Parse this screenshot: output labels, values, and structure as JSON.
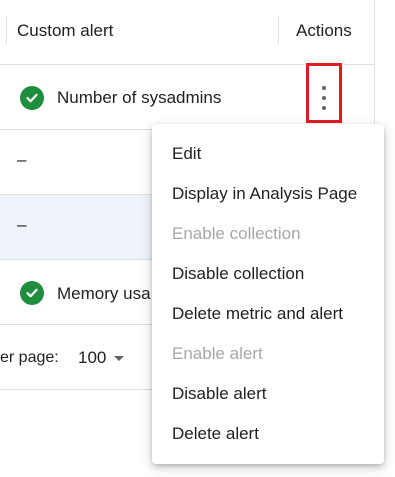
{
  "table": {
    "headers": {
      "custom_alert": "Custom alert",
      "actions": "Actions"
    },
    "rows": [
      {
        "status_icon": "check-circle-icon",
        "name": "Number of sysadmins"
      },
      {
        "name": "–"
      },
      {
        "name": "–",
        "selected": true
      },
      {
        "status_icon": "check-circle-icon",
        "name": "Memory usa"
      }
    ]
  },
  "pagination": {
    "rows_per_page_label": "er page:",
    "rows_per_page_value": "100"
  },
  "menu": {
    "items": [
      {
        "label": "Edit",
        "enabled": true
      },
      {
        "label": "Display in Analysis Page",
        "enabled": true
      },
      {
        "label": "Enable collection",
        "enabled": false
      },
      {
        "label": "Disable collection",
        "enabled": true
      },
      {
        "label": "Delete metric and alert",
        "enabled": true
      },
      {
        "label": "Enable alert",
        "enabled": false
      },
      {
        "label": "Disable alert",
        "enabled": true
      },
      {
        "label": "Delete alert",
        "enabled": true
      }
    ]
  },
  "colors": {
    "check": "#1e8e3e",
    "highlight": "#e01b24",
    "selected_row": "#eef3fc",
    "disabled_text": "#a6a6a6"
  }
}
